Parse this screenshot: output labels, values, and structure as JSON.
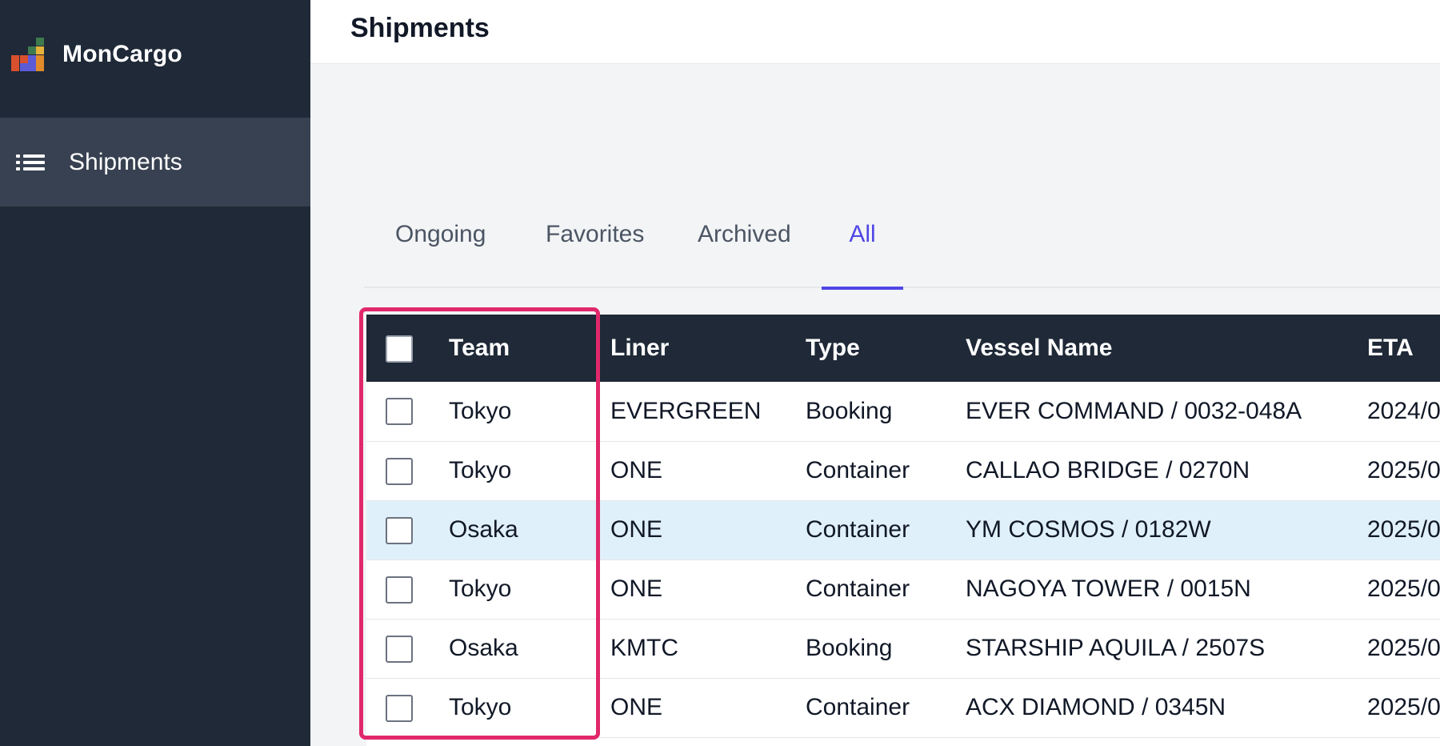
{
  "app": {
    "name": "MonCargo"
  },
  "sidebar": {
    "items": [
      {
        "label": "Shipments",
        "icon": "list-icon"
      }
    ]
  },
  "header": {
    "title": "Shipments"
  },
  "tabs": [
    {
      "label": "Ongoing",
      "active": false
    },
    {
      "label": "Favorites",
      "active": false
    },
    {
      "label": "Archived",
      "active": false
    },
    {
      "label": "All",
      "active": true
    }
  ],
  "table": {
    "columns": [
      "Team",
      "Liner",
      "Type",
      "Vessel Name",
      "ETA"
    ],
    "rows": [
      {
        "team": "Tokyo",
        "liner": "EVERGREEN",
        "type": "Booking",
        "vessel": "EVER COMMAND / 0032-048A",
        "eta": "2024/0"
      },
      {
        "team": "Tokyo",
        "liner": "ONE",
        "type": "Container",
        "vessel": "CALLAO BRIDGE / 0270N",
        "eta": "2025/0"
      },
      {
        "team": "Osaka",
        "liner": "ONE",
        "type": "Container",
        "vessel": "YM COSMOS / 0182W",
        "eta": "2025/0"
      },
      {
        "team": "Tokyo",
        "liner": "ONE",
        "type": "Container",
        "vessel": "NAGOYA TOWER / 0015N",
        "eta": "2025/0"
      },
      {
        "team": "Osaka",
        "liner": "KMTC",
        "type": "Booking",
        "vessel": "STARSHIP AQUILA / 2507S",
        "eta": "2025/0"
      },
      {
        "team": "Tokyo",
        "liner": "ONE",
        "type": "Container",
        "vessel": "ACX DIAMOND / 0345N",
        "eta": "2025/0"
      }
    ]
  },
  "colors": {
    "sidebar_bg": "#1f2937",
    "sidebar_active": "#374151",
    "accent": "#4f46e5",
    "highlight": "#e0286b",
    "row_highlight": "#e0f0fa"
  }
}
